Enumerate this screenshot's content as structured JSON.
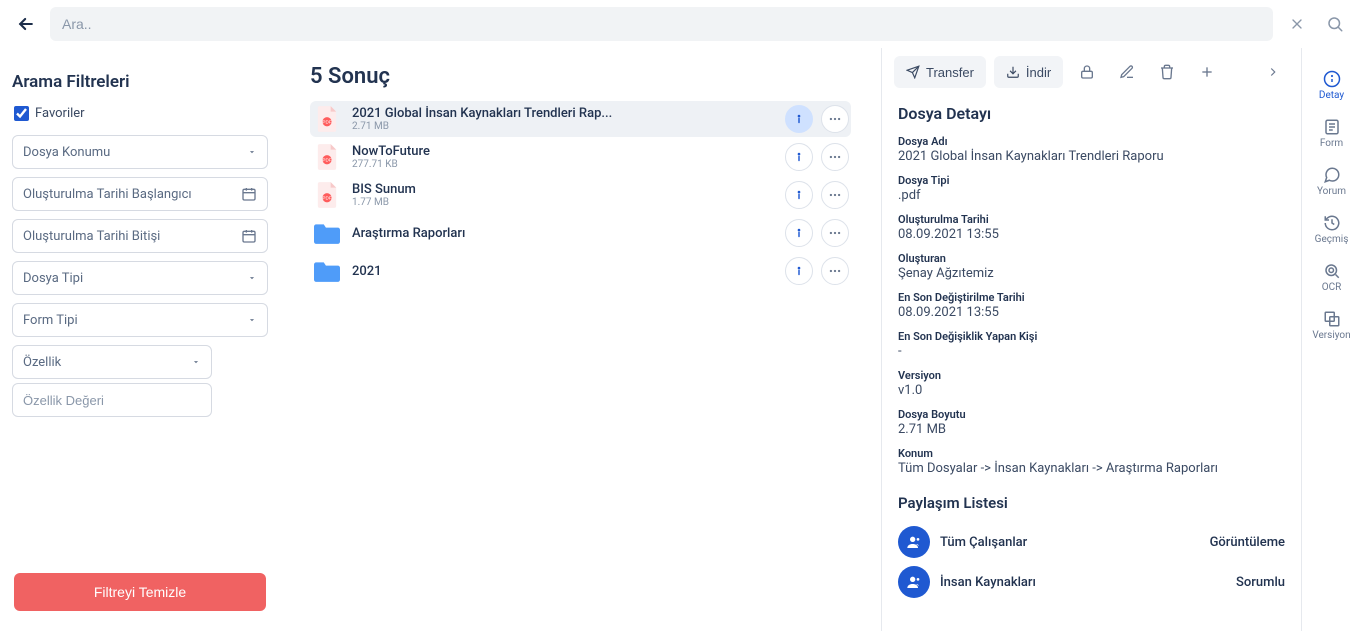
{
  "search": {
    "placeholder": "Ara.."
  },
  "filters": {
    "title": "Arama Filtreleri",
    "favorites_label": "Favoriler",
    "location_placeholder": "Dosya Konumu",
    "created_start_placeholder": "Oluşturulma Tarihi Başlangıcı",
    "created_end_placeholder": "Oluşturulma Tarihi Bitişi",
    "file_type_placeholder": "Dosya Tipi",
    "form_type_placeholder": "Form Tipi",
    "property_placeholder": "Özellik",
    "property_value_placeholder": "Özellik Değeri",
    "clear_label": "Filtreyi Temizle"
  },
  "results": {
    "title": "5 Sonuç",
    "items": [
      {
        "type": "pdf",
        "name": "2021 Global İnsan Kaynakları Trendleri Rap...",
        "size": "2.71 MB",
        "selected": true
      },
      {
        "type": "pdf",
        "name": "NowToFuture",
        "size": "277.71 KB",
        "selected": false
      },
      {
        "type": "pdf",
        "name": "BIS Sunum",
        "size": "1.77 MB",
        "selected": false
      },
      {
        "type": "folder",
        "name": "Araştırma Raporları",
        "size": "",
        "selected": false
      },
      {
        "type": "folder",
        "name": "2021",
        "size": "",
        "selected": false
      }
    ]
  },
  "detail": {
    "toolbar": {
      "transfer": "Transfer",
      "download": "İndir"
    },
    "heading": "Dosya Detayı",
    "fields": {
      "name_label": "Dosya Adı",
      "name_value": "2021 Global İnsan Kaynakları Trendleri Raporu",
      "type_label": "Dosya Tipi",
      "type_value": ".pdf",
      "created_label": "Oluşturulma Tarihi",
      "created_value": "08.09.2021 13:55",
      "creator_label": "Oluşturan",
      "creator_value": "Şenay Ağzıtemiz",
      "modified_label": "En Son Değiştirilme Tarihi",
      "modified_value": "08.09.2021 13:55",
      "modifier_label": "En Son Değişiklik Yapan Kişi",
      "modifier_value": "-",
      "version_label": "Versiyon",
      "version_value": "v1.0",
      "size_label": "Dosya Boyutu",
      "size_value": "2.71 MB",
      "location_label": "Konum",
      "location_value": "Tüm Dosyalar -> İnsan Kaynakları -> Araştırma Raporları"
    },
    "share": {
      "title": "Paylaşım Listesi",
      "rows": [
        {
          "name": "Tüm Çalışanlar",
          "role": "Görüntüleme"
        },
        {
          "name": "İnsan Kaynakları",
          "role": "Sorumlu"
        }
      ]
    }
  },
  "tabs": {
    "detail": "Detay",
    "form": "Form",
    "comment": "Yorum",
    "history": "Geçmiş",
    "ocr": "OCR",
    "version": "Versiyon"
  }
}
